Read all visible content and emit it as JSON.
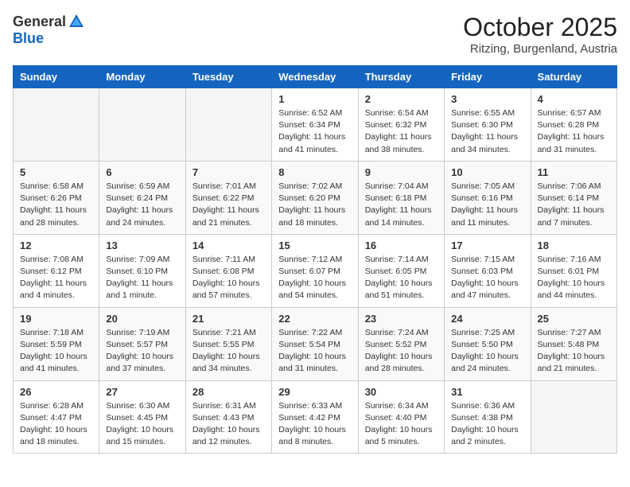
{
  "header": {
    "logo_general": "General",
    "logo_blue": "Blue",
    "month_title": "October 2025",
    "location": "Ritzing, Burgenland, Austria"
  },
  "days_of_week": [
    "Sunday",
    "Monday",
    "Tuesday",
    "Wednesday",
    "Thursday",
    "Friday",
    "Saturday"
  ],
  "weeks": [
    [
      {
        "day": "",
        "info": ""
      },
      {
        "day": "",
        "info": ""
      },
      {
        "day": "",
        "info": ""
      },
      {
        "day": "1",
        "info": "Sunrise: 6:52 AM\nSunset: 6:34 PM\nDaylight: 11 hours\nand 41 minutes."
      },
      {
        "day": "2",
        "info": "Sunrise: 6:54 AM\nSunset: 6:32 PM\nDaylight: 11 hours\nand 38 minutes."
      },
      {
        "day": "3",
        "info": "Sunrise: 6:55 AM\nSunset: 6:30 PM\nDaylight: 11 hours\nand 34 minutes."
      },
      {
        "day": "4",
        "info": "Sunrise: 6:57 AM\nSunset: 6:28 PM\nDaylight: 11 hours\nand 31 minutes."
      }
    ],
    [
      {
        "day": "5",
        "info": "Sunrise: 6:58 AM\nSunset: 6:26 PM\nDaylight: 11 hours\nand 28 minutes."
      },
      {
        "day": "6",
        "info": "Sunrise: 6:59 AM\nSunset: 6:24 PM\nDaylight: 11 hours\nand 24 minutes."
      },
      {
        "day": "7",
        "info": "Sunrise: 7:01 AM\nSunset: 6:22 PM\nDaylight: 11 hours\nand 21 minutes."
      },
      {
        "day": "8",
        "info": "Sunrise: 7:02 AM\nSunset: 6:20 PM\nDaylight: 11 hours\nand 18 minutes."
      },
      {
        "day": "9",
        "info": "Sunrise: 7:04 AM\nSunset: 6:18 PM\nDaylight: 11 hours\nand 14 minutes."
      },
      {
        "day": "10",
        "info": "Sunrise: 7:05 AM\nSunset: 6:16 PM\nDaylight: 11 hours\nand 11 minutes."
      },
      {
        "day": "11",
        "info": "Sunrise: 7:06 AM\nSunset: 6:14 PM\nDaylight: 11 hours\nand 7 minutes."
      }
    ],
    [
      {
        "day": "12",
        "info": "Sunrise: 7:08 AM\nSunset: 6:12 PM\nDaylight: 11 hours\nand 4 minutes."
      },
      {
        "day": "13",
        "info": "Sunrise: 7:09 AM\nSunset: 6:10 PM\nDaylight: 11 hours\nand 1 minute."
      },
      {
        "day": "14",
        "info": "Sunrise: 7:11 AM\nSunset: 6:08 PM\nDaylight: 10 hours\nand 57 minutes."
      },
      {
        "day": "15",
        "info": "Sunrise: 7:12 AM\nSunset: 6:07 PM\nDaylight: 10 hours\nand 54 minutes."
      },
      {
        "day": "16",
        "info": "Sunrise: 7:14 AM\nSunset: 6:05 PM\nDaylight: 10 hours\nand 51 minutes."
      },
      {
        "day": "17",
        "info": "Sunrise: 7:15 AM\nSunset: 6:03 PM\nDaylight: 10 hours\nand 47 minutes."
      },
      {
        "day": "18",
        "info": "Sunrise: 7:16 AM\nSunset: 6:01 PM\nDaylight: 10 hours\nand 44 minutes."
      }
    ],
    [
      {
        "day": "19",
        "info": "Sunrise: 7:18 AM\nSunset: 5:59 PM\nDaylight: 10 hours\nand 41 minutes."
      },
      {
        "day": "20",
        "info": "Sunrise: 7:19 AM\nSunset: 5:57 PM\nDaylight: 10 hours\nand 37 minutes."
      },
      {
        "day": "21",
        "info": "Sunrise: 7:21 AM\nSunset: 5:55 PM\nDaylight: 10 hours\nand 34 minutes."
      },
      {
        "day": "22",
        "info": "Sunrise: 7:22 AM\nSunset: 5:54 PM\nDaylight: 10 hours\nand 31 minutes."
      },
      {
        "day": "23",
        "info": "Sunrise: 7:24 AM\nSunset: 5:52 PM\nDaylight: 10 hours\nand 28 minutes."
      },
      {
        "day": "24",
        "info": "Sunrise: 7:25 AM\nSunset: 5:50 PM\nDaylight: 10 hours\nand 24 minutes."
      },
      {
        "day": "25",
        "info": "Sunrise: 7:27 AM\nSunset: 5:48 PM\nDaylight: 10 hours\nand 21 minutes."
      }
    ],
    [
      {
        "day": "26",
        "info": "Sunrise: 6:28 AM\nSunset: 4:47 PM\nDaylight: 10 hours\nand 18 minutes."
      },
      {
        "day": "27",
        "info": "Sunrise: 6:30 AM\nSunset: 4:45 PM\nDaylight: 10 hours\nand 15 minutes."
      },
      {
        "day": "28",
        "info": "Sunrise: 6:31 AM\nSunset: 4:43 PM\nDaylight: 10 hours\nand 12 minutes."
      },
      {
        "day": "29",
        "info": "Sunrise: 6:33 AM\nSunset: 4:42 PM\nDaylight: 10 hours\nand 8 minutes."
      },
      {
        "day": "30",
        "info": "Sunrise: 6:34 AM\nSunset: 4:40 PM\nDaylight: 10 hours\nand 5 minutes."
      },
      {
        "day": "31",
        "info": "Sunrise: 6:36 AM\nSunset: 4:38 PM\nDaylight: 10 hours\nand 2 minutes."
      },
      {
        "day": "",
        "info": ""
      }
    ]
  ]
}
